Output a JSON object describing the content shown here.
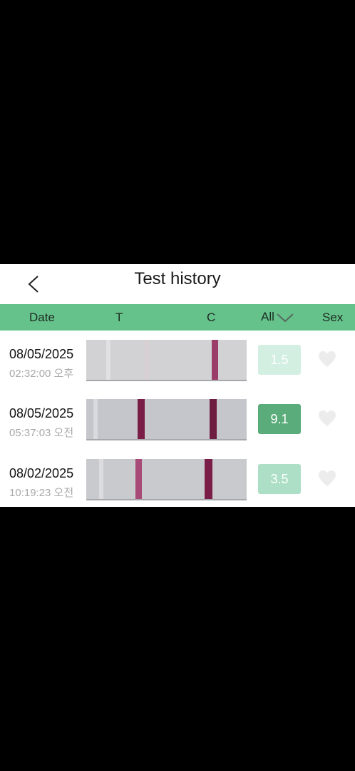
{
  "header": {
    "title": "Test history"
  },
  "columns": {
    "date": "Date",
    "t": "T",
    "c": "C",
    "all": "All",
    "sex": "Sex"
  },
  "icons": {
    "back": "chevron-left-icon",
    "sort": "chevron-down-icon",
    "favorite": "heart-icon"
  },
  "colors": {
    "column_bar": "#66c28b",
    "badge_high": "#5aad7a",
    "badge_mid": "#acdfc5",
    "badge_low": "#d3efe2",
    "line": "#7a1e47"
  },
  "rows": [
    {
      "date": "08/05/2025",
      "time": "02:32:00 오후",
      "value": "1.5"
    },
    {
      "date": "08/05/2025",
      "time": "05:37:03 오전",
      "value": "9.1"
    },
    {
      "date": "08/02/2025",
      "time": "10:19:23 오전",
      "value": "3.5"
    }
  ]
}
